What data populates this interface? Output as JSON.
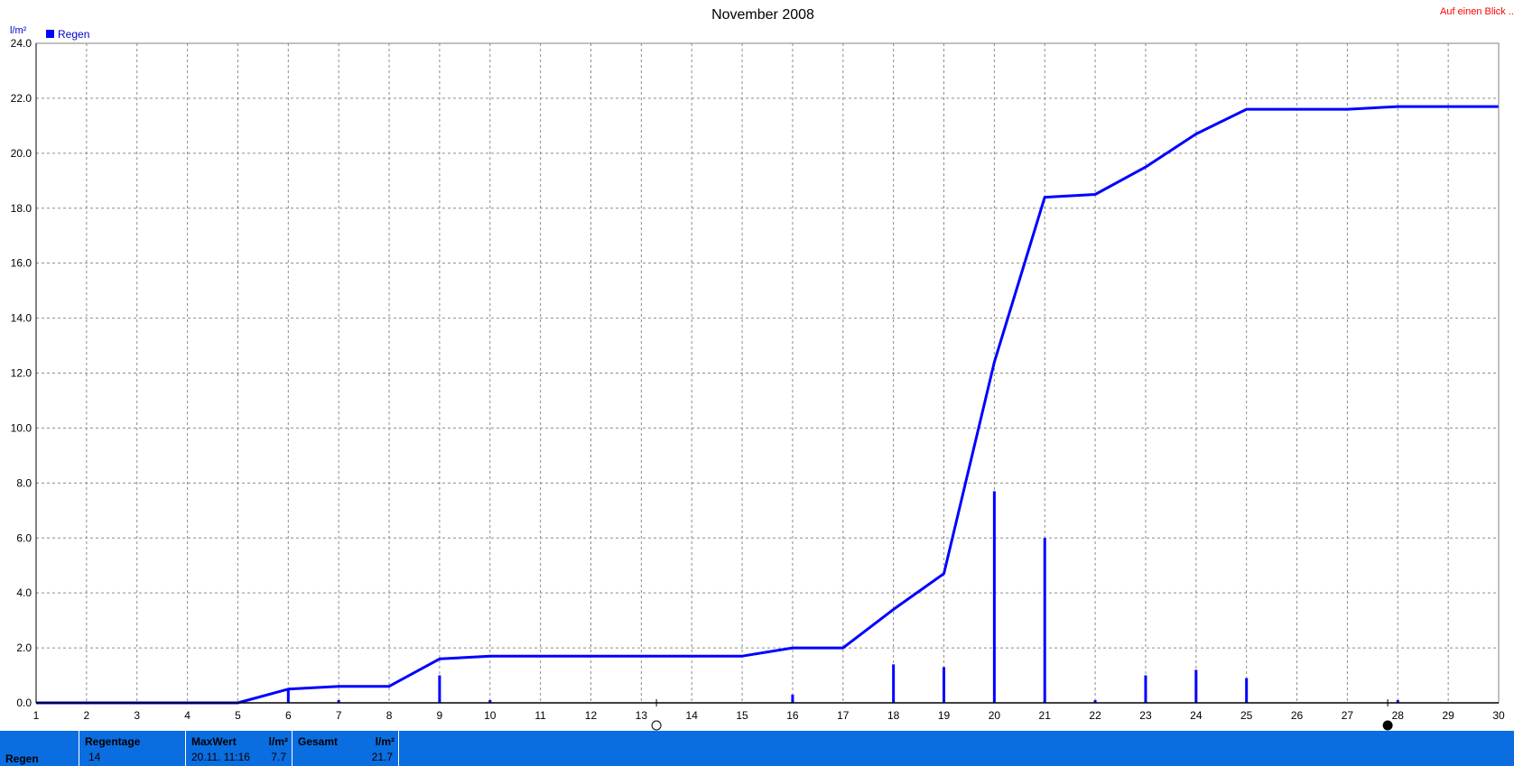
{
  "header": {
    "title": "November 2008",
    "unit": "l/m²",
    "link": "Auf einen Blick ..."
  },
  "legend": {
    "label": "Regen",
    "color": "#0000ff"
  },
  "moon_icons": [
    {
      "name": "full-moon-icon",
      "day": 13.3
    },
    {
      "name": "new-moon-icon",
      "day": 27.8
    }
  ],
  "chart_data": {
    "type": "bar",
    "title": "November 2008",
    "ylabel": "l/m²",
    "xlim": [
      1,
      30
    ],
    "ylim": [
      0,
      24
    ],
    "x_ticks": [
      1,
      2,
      3,
      4,
      5,
      6,
      7,
      8,
      9,
      10,
      11,
      12,
      13,
      14,
      15,
      16,
      17,
      18,
      19,
      20,
      21,
      22,
      23,
      24,
      25,
      26,
      27,
      28,
      29,
      30
    ],
    "y_ticks": [
      "0.0",
      "2.0",
      "4.0",
      "6.0",
      "8.0",
      "10.0",
      "12.0",
      "14.0",
      "16.0",
      "18.0",
      "20.0",
      "22.0",
      "24.0"
    ],
    "grid": true,
    "legend_position": "top-left",
    "series": [
      {
        "name": "Regen",
        "kind": "bar",
        "color": "#0000ff",
        "x": [
          6,
          7,
          9,
          10,
          16,
          18,
          19,
          20,
          21,
          22,
          23,
          24,
          25,
          28
        ],
        "values": [
          0.5,
          0.1,
          1.0,
          0.1,
          0.3,
          1.4,
          1.3,
          7.7,
          6.0,
          0.1,
          1.0,
          1.2,
          0.9,
          0.1
        ]
      },
      {
        "kind": "line",
        "color": "#0000ff",
        "x": [
          1,
          5,
          6,
          7,
          8,
          9,
          10,
          15,
          16,
          17,
          18,
          19,
          20,
          21,
          22,
          23,
          24,
          25,
          27,
          28,
          30
        ],
        "values": [
          0,
          0,
          0.5,
          0.6,
          0.6,
          1.6,
          1.7,
          1.7,
          2.0,
          2.0,
          3.4,
          4.7,
          12.4,
          18.4,
          18.5,
          19.5,
          20.7,
          21.6,
          21.6,
          21.7,
          21.7
        ]
      }
    ]
  },
  "footer": {
    "row_label": "Regen",
    "regentage": {
      "label": "Regentage",
      "value": "14"
    },
    "maxwert": {
      "label": "MaxWert",
      "unit": "l/m²",
      "date": "20.11.  11:16",
      "value": "7.7"
    },
    "gesamt": {
      "label": "Gesamt",
      "unit": "l/m²",
      "value": "21.7"
    }
  }
}
